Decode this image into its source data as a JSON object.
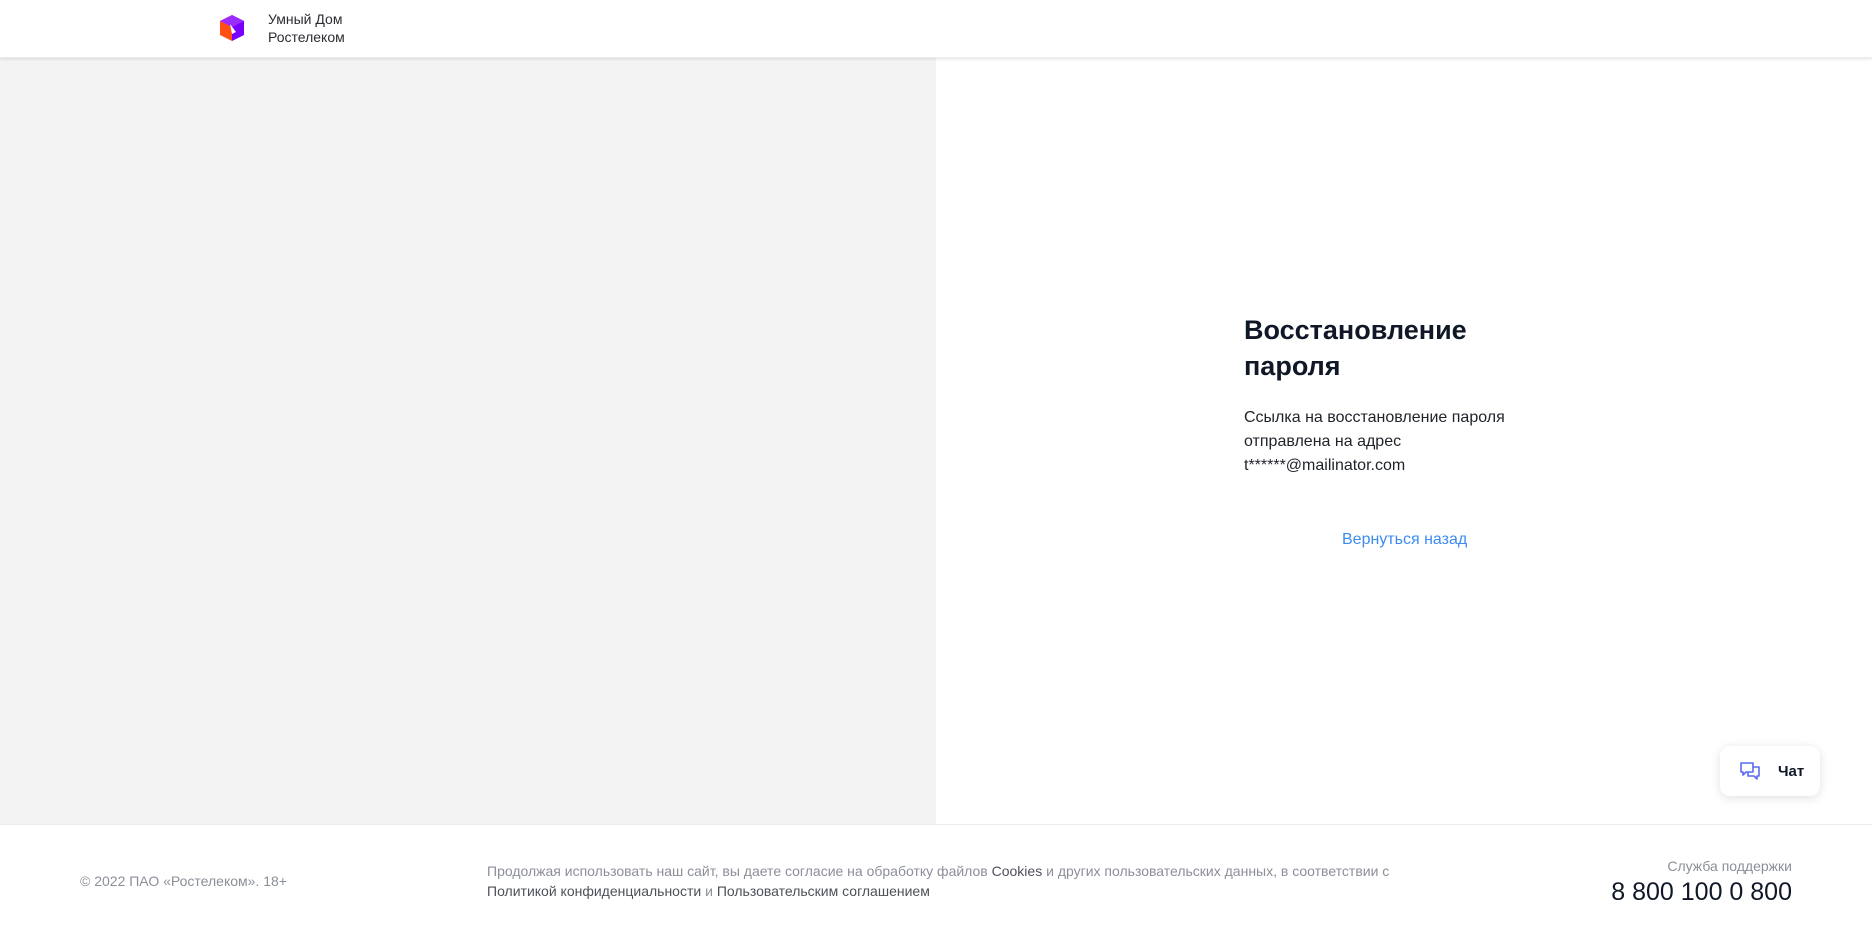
{
  "header": {
    "brand_line1": "Умный Дом",
    "brand_line2": "Ростелеком",
    "logo_colors": {
      "purple": "#7700ff",
      "orange": "#ff4f12"
    }
  },
  "recovery": {
    "title": "Восстановление пароля",
    "message_line1": "Ссылка на восстановление пароля",
    "message_line2": "отправлена на адрес",
    "email": "t******@mailinator.com",
    "back_link": "Вернуться назад"
  },
  "chat": {
    "label": "Чат",
    "icon": "chat-bubbles-icon"
  },
  "footer": {
    "copyright": "© 2022 ПАО «Ростелеком». 18+",
    "consent_prefix": "Продолжая использовать наш сайт, вы даете согласие на обработку файлов",
    "cookies_link": "Cookies",
    "consent_middle": "и других пользовательских данных, в соответствии с",
    "privacy_link": "Политикой конфиденциальности",
    "consent_and": "и",
    "terms_link": "Пользовательским соглашением",
    "support_label": "Служба поддержки",
    "support_phone": "8 800 100 0 800"
  },
  "colors": {
    "accent_link": "#3c8cf0",
    "left_panel_bg": "#f3f3f3",
    "chat_icon": "#5a6cf0"
  }
}
